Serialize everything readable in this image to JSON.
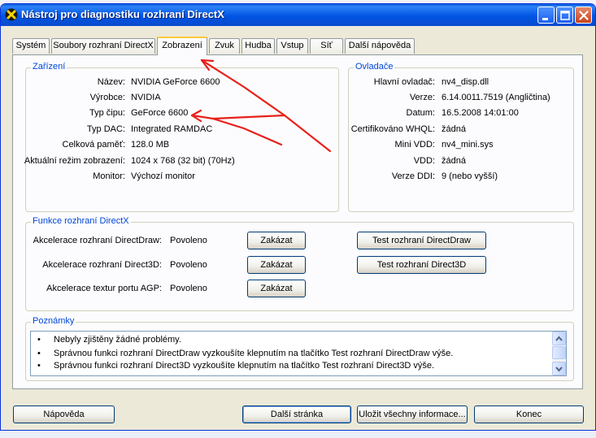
{
  "window": {
    "title": "Nástroj pro diagnostiku rozhraní DirectX"
  },
  "tabs": [
    {
      "label": "Systém"
    },
    {
      "label": "Soubory rozhraní DirectX"
    },
    {
      "label": "Zobrazení",
      "active": true
    },
    {
      "label": "Zvuk"
    },
    {
      "label": "Hudba"
    },
    {
      "label": "Vstup"
    },
    {
      "label": "Síť"
    },
    {
      "label": "Další nápověda"
    }
  ],
  "device": {
    "title": "Zařízení",
    "rows": [
      {
        "label": "Název:",
        "value": "NVIDIA GeForce 6600"
      },
      {
        "label": "Výrobce:",
        "value": "NVIDIA"
      },
      {
        "label": "Typ čipu:",
        "value": "GeForce 6600"
      },
      {
        "label": "Typ DAC:",
        "value": "Integrated RAMDAC"
      },
      {
        "label": "Celková paměť:",
        "value": "128.0 MB"
      },
      {
        "label": "Aktuální režim zobrazení:",
        "value": "1024 x 768 (32 bit) (70Hz)"
      },
      {
        "label": "Monitor:",
        "value": "Výchozí monitor"
      }
    ]
  },
  "drivers": {
    "title": "Ovladače",
    "rows": [
      {
        "label": "Hlavní ovladač:",
        "value": "nv4_disp.dll"
      },
      {
        "label": "Verze:",
        "value": "6.14.0011.7519 (Angličtina)"
      },
      {
        "label": "Datum:",
        "value": "16.5.2008 14:01:00"
      },
      {
        "label": "Certifikováno WHQL:",
        "value": "žádná"
      },
      {
        "label": "Mini VDD:",
        "value": "nv4_mini.sys"
      },
      {
        "label": "VDD:",
        "value": "žádná"
      },
      {
        "label": "Verze DDI:",
        "value": "9 (nebo vyšší)"
      }
    ]
  },
  "features": {
    "title": "Funkce rozhraní DirectX",
    "rows": [
      {
        "label": "Akcelerace rozhraní DirectDraw:",
        "status": "Povoleno",
        "disable_label": "Zakázat",
        "test_label": "Test rozhraní DirectDraw"
      },
      {
        "label": "Akcelerace rozhraní Direct3D:",
        "status": "Povoleno",
        "disable_label": "Zakázat",
        "test_label": "Test rozhraní Direct3D"
      },
      {
        "label": "Akcelerace textur portu AGP:",
        "status": "Povoleno",
        "disable_label": "Zakázat"
      }
    ]
  },
  "notes": {
    "title": "Poznámky",
    "bullet": "•",
    "items": [
      "Nebyly zjištěny žádné problémy.",
      "Správnou funkci rozhraní DirectDraw vyzkoušíte klepnutím na tlačítko Test rozhraní DirectDraw výše.",
      "Správnou funkci rozhraní Direct3D vyzkoušíte klepnutím na tlačítko Test rozhraní Direct3D výše."
    ]
  },
  "footer": {
    "help_label": "Nápověda",
    "next_label": "Další stránka",
    "save_label": "Uložit všechny informace...",
    "exit_label": "Konec"
  },
  "annotation": {
    "arrow_color": "#e8201a"
  }
}
